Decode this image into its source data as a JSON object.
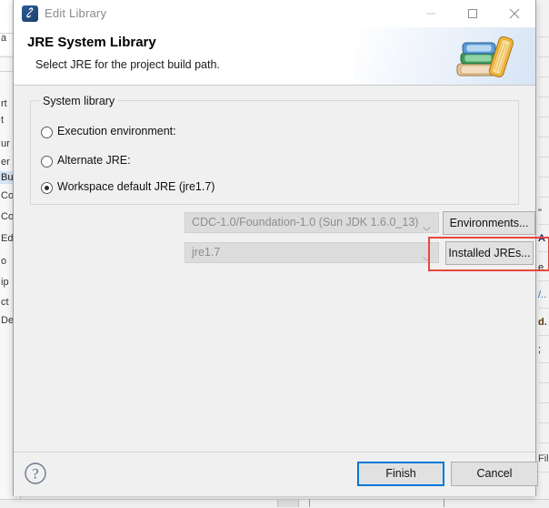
{
  "window": {
    "title": "Edit Library",
    "icon": "eclipse-library-icon",
    "controls": {
      "minimize": "minimize-icon",
      "maximize": "maximize-icon",
      "close": "close-icon"
    }
  },
  "header": {
    "title": "JRE System Library",
    "subtitle": "Select JRE for the project build path.",
    "banner_icon": "books-stack-icon"
  },
  "main": {
    "group": {
      "legend": "System library",
      "options": [
        {
          "id": "execution-environment",
          "label": "Execution environment:",
          "selected": false,
          "combo_value": "CDC-1.0/Foundation-1.0 (Sun JDK 1.6.0_13)",
          "combo_enabled": false,
          "button": "Environments..."
        },
        {
          "id": "alternate-jre",
          "label": "Alternate JRE:",
          "selected": false,
          "combo_value": "jre1.7",
          "combo_enabled": false,
          "button": "Installed JREs..."
        },
        {
          "id": "workspace-default-jre",
          "label": "Workspace default JRE (jre1.7)",
          "selected": true
        }
      ]
    },
    "highlight": {
      "name": "installed-jres-highlight",
      "color": "#e8473f"
    }
  },
  "footer": {
    "help": "?",
    "finish_label": "Finish",
    "cancel_label": "Cancel",
    "focus_color": "#0078d7"
  },
  "background": {
    "left_fragments": [
      "a",
      "rt",
      " t",
      "ur",
      "er",
      "Bu",
      "Co",
      "Co",
      "Ed",
      "o",
      "ip",
      "ct",
      "De"
    ],
    "right_fragments": [
      "\"",
      "A",
      "e",
      "/..",
      "d.",
      ";"
    ],
    "bottom_fragment": "Fil"
  }
}
